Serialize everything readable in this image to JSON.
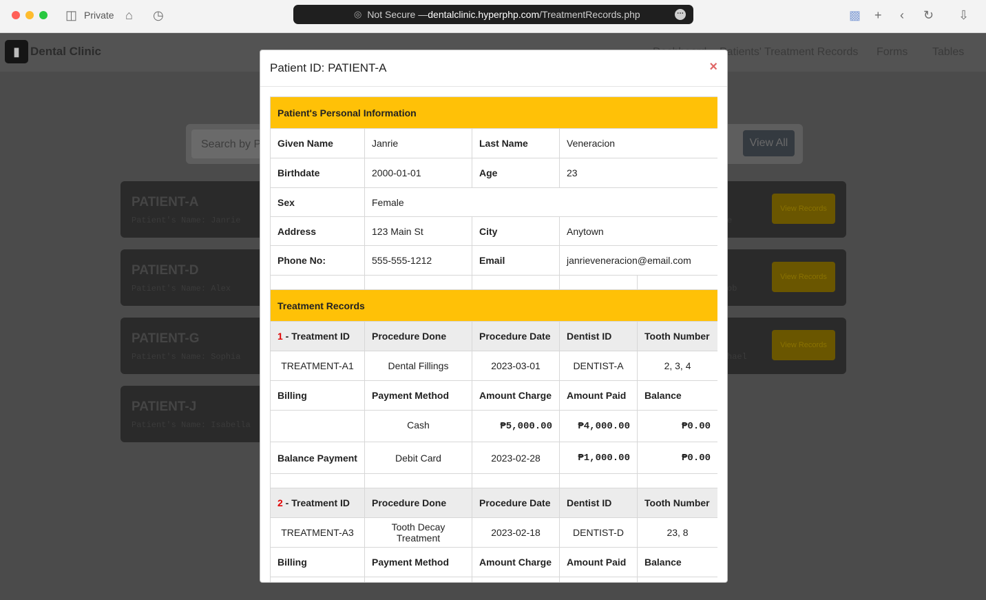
{
  "browser": {
    "private_label": "Private",
    "url_prefix": "Not Secure — ",
    "url_host": "dentalclinic.hyperphp.com",
    "url_path": "/TreatmentRecords.php"
  },
  "site": {
    "brand": "Dental Clinic",
    "nav": [
      "Dashboard",
      "Patients' Treatment Records",
      "Forms",
      "Tables"
    ],
    "search_placeholder": "Search by P",
    "view_all": "View All",
    "view_records": "View Records",
    "patients": [
      {
        "id": "PATIENT-A",
        "name_line": "Patient's Name: Janrie",
        "right_text": "e"
      },
      {
        "id": "PATIENT-D",
        "name_line": "Patient's Name: Alex",
        "right_text": "ob"
      },
      {
        "id": "PATIENT-G",
        "name_line": "Patient's Name: Sophia",
        "right_text": "hael"
      },
      {
        "id": "PATIENT-J",
        "name_line": "Patient's Name: Isabella",
        "right_text": ""
      }
    ]
  },
  "modal": {
    "title": "Patient ID: PATIENT-A",
    "close": "×",
    "personal_heading": "Patient's Personal Information",
    "personal": {
      "given_name_label": "Given Name",
      "given_name": "Janrie",
      "last_name_label": "Last Name",
      "last_name": "Veneracion",
      "birthdate_label": "Birthdate",
      "birthdate": "2000-01-01",
      "age_label": "Age",
      "age": "23",
      "sex_label": "Sex",
      "sex": "Female",
      "address_label": "Address",
      "address": "123 Main St",
      "city_label": "City",
      "city": "Anytown",
      "phone_label": "Phone No:",
      "phone": "555-555-1212",
      "email_label": "Email",
      "email": "janrieveneracion@email.com"
    },
    "treatment_heading": "Treatment Records",
    "columns": {
      "treatment_id": " - Treatment ID",
      "procedure_done": "Procedure Done",
      "procedure_date": "Procedure Date",
      "dentist_id": "Dentist ID",
      "tooth_number": "Tooth Number"
    },
    "billing_columns": {
      "billing": "Billing",
      "payment_method": "Payment Method",
      "amount_charge": "Amount Charge",
      "amount_paid": "Amount Paid",
      "balance": "Balance"
    },
    "balance_payment_label": "Balance Payment",
    "records": [
      {
        "num": "1",
        "treatment_id": "TREATMENT-A1",
        "procedure": "Dental Fillings",
        "date": "2023-03-01",
        "dentist": "DENTIST-A",
        "tooth": "2, 3, 4",
        "payment_method": "Cash",
        "amount_charge": "₱5,000.00",
        "amount_paid": "₱4,000.00",
        "balance": "₱0.00",
        "bp_method": "Debit Card",
        "bp_date": "2023-02-28",
        "bp_amount": "₱1,000.00",
        "bp_balance": "₱0.00"
      },
      {
        "num": "2",
        "treatment_id": "TREATMENT-A3",
        "procedure": "Tooth Decay Treatment",
        "date": "2023-02-18",
        "dentist": "DENTIST-D",
        "tooth": "23, 8"
      }
    ]
  }
}
